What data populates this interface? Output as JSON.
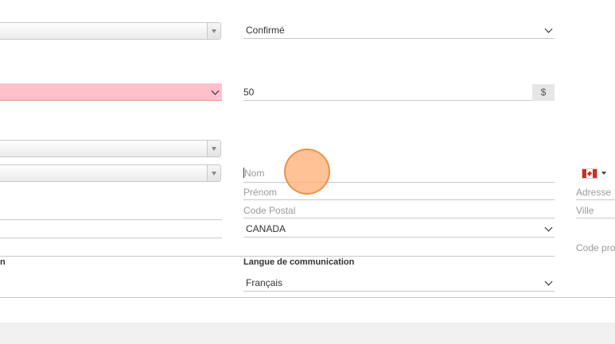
{
  "left_column": {
    "label_partial": "n"
  },
  "status_select": {
    "value": "Confirmé"
  },
  "amount": {
    "value": "50",
    "currency_symbol": "$"
  },
  "contact": {
    "nom_placeholder": "Nom",
    "prenom_placeholder": "Prénom",
    "code_postal_placeholder": "Code Postal",
    "country_value": "CANADA",
    "language_label": "Langue de communication",
    "language_value": "Français"
  },
  "right_column": {
    "adresse_placeholder": "Adresse",
    "ville_placeholder": "Ville",
    "code_province_placeholder": "Code pro"
  },
  "colors": {
    "error_background": "#ffc0cb",
    "cursor_highlight": "#ffaa6e"
  }
}
